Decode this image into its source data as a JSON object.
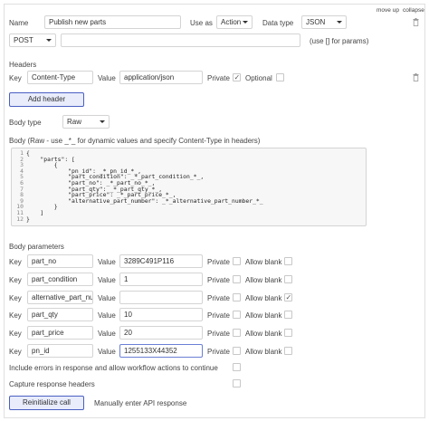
{
  "top_links": {
    "move_up": "move up",
    "collapse": "collapse"
  },
  "call": {
    "name_label": "Name",
    "name_value": "Publish new parts",
    "use_as_label": "Use as",
    "use_as_value": "Action",
    "data_type_label": "Data type",
    "data_type_value": "JSON",
    "method_value": "POST",
    "url_value": "",
    "url_hint": "(use [] for params)"
  },
  "headers": {
    "section_label": "Headers",
    "key_label": "Key",
    "key_value": "Content-Type",
    "value_label": "Value",
    "value_value": "application/json",
    "private_label": "Private",
    "private_checked": true,
    "optional_label": "Optional",
    "add_header_label": "Add header"
  },
  "body": {
    "type_label": "Body type",
    "type_value": "Raw",
    "raw_label": "Body (Raw - use _*_ for dynamic values and specify Content-Type in headers)",
    "line_numbers": [
      "1",
      "2",
      "3",
      "4",
      "5",
      "6",
      "7",
      "8",
      "9",
      "10",
      "11",
      "12"
    ],
    "code_lines": [
      "{",
      "    \"parts\": [",
      "        {",
      "            \"pn_id\": _*_pn_id_*_,",
      "            \"part_condition\": _*_part_condition_*_,",
      "            \"part_no\": _*_part_no_*_,",
      "            \"part_qty\": _*_part_qty_*_,",
      "            \"part_price\": _*_part_price_*_,",
      "            \"alternative_part_number\": _*_alternative_part_number_*_",
      "        }",
      "    ]",
      "}"
    ]
  },
  "body_params": {
    "section_label": "Body parameters",
    "key_label": "Key",
    "value_label": "Value",
    "private_label": "Private",
    "allow_blank_label": "Allow blank",
    "rows": [
      {
        "key": "part_no",
        "value": "3289C491P116",
        "allow_blank": false
      },
      {
        "key": "part_condition",
        "value": "1",
        "allow_blank": false
      },
      {
        "key": "alternative_part_num",
        "value": "",
        "allow_blank": true
      },
      {
        "key": "part_qty",
        "value": "10",
        "allow_blank": false
      },
      {
        "key": "part_price",
        "value": "20",
        "allow_blank": false
      },
      {
        "key": "pn_id",
        "value": "1255133X44352",
        "allow_blank": false
      }
    ]
  },
  "options": {
    "include_errors_label": "Include errors in response and allow workflow actions to continue",
    "capture_headers_label": "Capture response headers"
  },
  "footer": {
    "reinitialize_label": "Reinitialize call",
    "manual_label": "Manually enter API response"
  },
  "colors": {
    "accent": "#4a5fc1",
    "button_bg": "#e8ecfb",
    "border": "#d4d4d4"
  }
}
